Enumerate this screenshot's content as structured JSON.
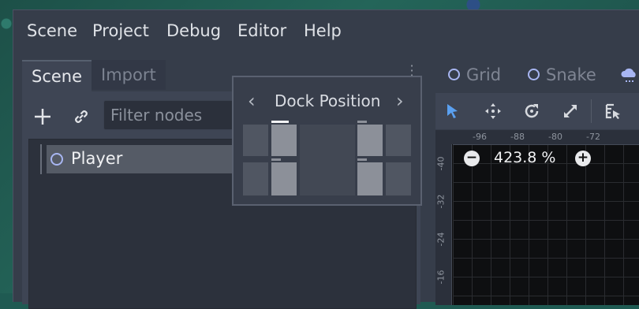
{
  "menubar": {
    "items": [
      "Scene",
      "Project",
      "Debug",
      "Editor",
      "Help"
    ]
  },
  "scene_dock": {
    "tabs": [
      {
        "label": "Scene",
        "active": true
      },
      {
        "label": "Import",
        "active": false
      }
    ],
    "filter": {
      "placeholder": "Filter nodes",
      "value": ""
    },
    "tree": {
      "nodes": [
        {
          "label": "Player",
          "icon": "node2d-ring-icon",
          "selected": true
        }
      ]
    }
  },
  "dock_position_popup": {
    "title": "Dock Position",
    "prev_icon": "chevron-left-icon",
    "next_icon": "chevron-right-icon"
  },
  "viewport": {
    "tabs": [
      {
        "label": "Grid",
        "icon": "ring-icon"
      },
      {
        "label": "Snake",
        "icon": "ring-icon"
      }
    ],
    "zoom": {
      "value": "423.8 %",
      "minus": "−",
      "plus": "+"
    },
    "ruler_top_labels": [
      "-96",
      "-88",
      "-80",
      "-72"
    ],
    "ruler_left_labels": [
      "-40",
      "-32",
      "-24",
      "-16"
    ]
  },
  "colors": {
    "accent_ring": "#a8b6f2",
    "selection_row": "#555b66",
    "cursor_tool": "#5aa0f0"
  }
}
